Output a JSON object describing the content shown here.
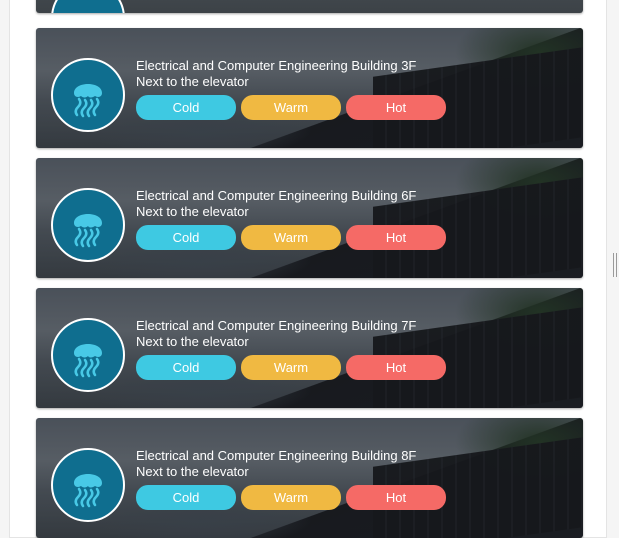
{
  "colors": {
    "cold": "#3ec9e2",
    "warm": "#f0b942",
    "hot": "#f56a66",
    "avatar_bg": "#0f6e8f"
  },
  "cards": [
    {
      "icon": "jellyfish-icon",
      "title": "Electrical and Computer Engineering Building 3F",
      "subtitle": "Next to the elevator",
      "buttons": {
        "cold": "Cold",
        "warm": "Warm",
        "hot": "Hot"
      }
    },
    {
      "icon": "jellyfish-icon",
      "title": "Electrical and Computer Engineering Building 6F",
      "subtitle": "Next to the elevator",
      "buttons": {
        "cold": "Cold",
        "warm": "Warm",
        "hot": "Hot"
      }
    },
    {
      "icon": "jellyfish-icon",
      "title": "Electrical and Computer Engineering Building 7F",
      "subtitle": "Next to the elevator",
      "buttons": {
        "cold": "Cold",
        "warm": "Warm",
        "hot": "Hot"
      }
    },
    {
      "icon": "jellyfish-icon",
      "title": "Electrical and Computer Engineering Building 8F",
      "subtitle": "Next to the elevator",
      "buttons": {
        "cold": "Cold",
        "warm": "Warm",
        "hot": "Hot"
      }
    }
  ]
}
